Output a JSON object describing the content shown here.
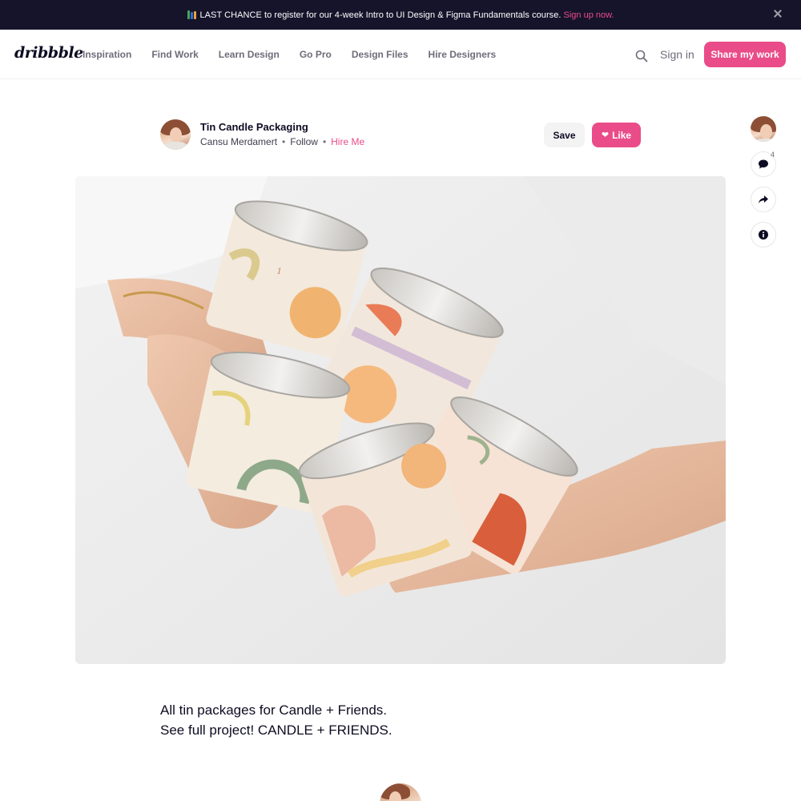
{
  "banner": {
    "icon": "books-icon",
    "message": "LAST CHANCE to register for our 4-week Intro to UI Design & Figma Fundamentals course.",
    "cta": "Sign up now."
  },
  "header": {
    "logo": "dribbble",
    "nav": [
      "Inspiration",
      "Find Work",
      "Learn Design",
      "Go Pro",
      "Design Files",
      "Hire Designers"
    ],
    "sign_in": "Sign in",
    "share": "Share my work"
  },
  "shot": {
    "title": "Tin Candle Packaging",
    "author": "Cansu Merdamert",
    "follow": "Follow",
    "hire": "Hire Me",
    "separator": "•",
    "save": "Save",
    "like": "Like",
    "comment_count": "4"
  },
  "description": {
    "line1": "All tin packages for Candle + Friends.",
    "line2": "See full project! CANDLE + FRIENDS."
  },
  "colors": {
    "brand": "#ea4c89",
    "banner_bg": "#15142b",
    "text": "#0d0c22"
  }
}
